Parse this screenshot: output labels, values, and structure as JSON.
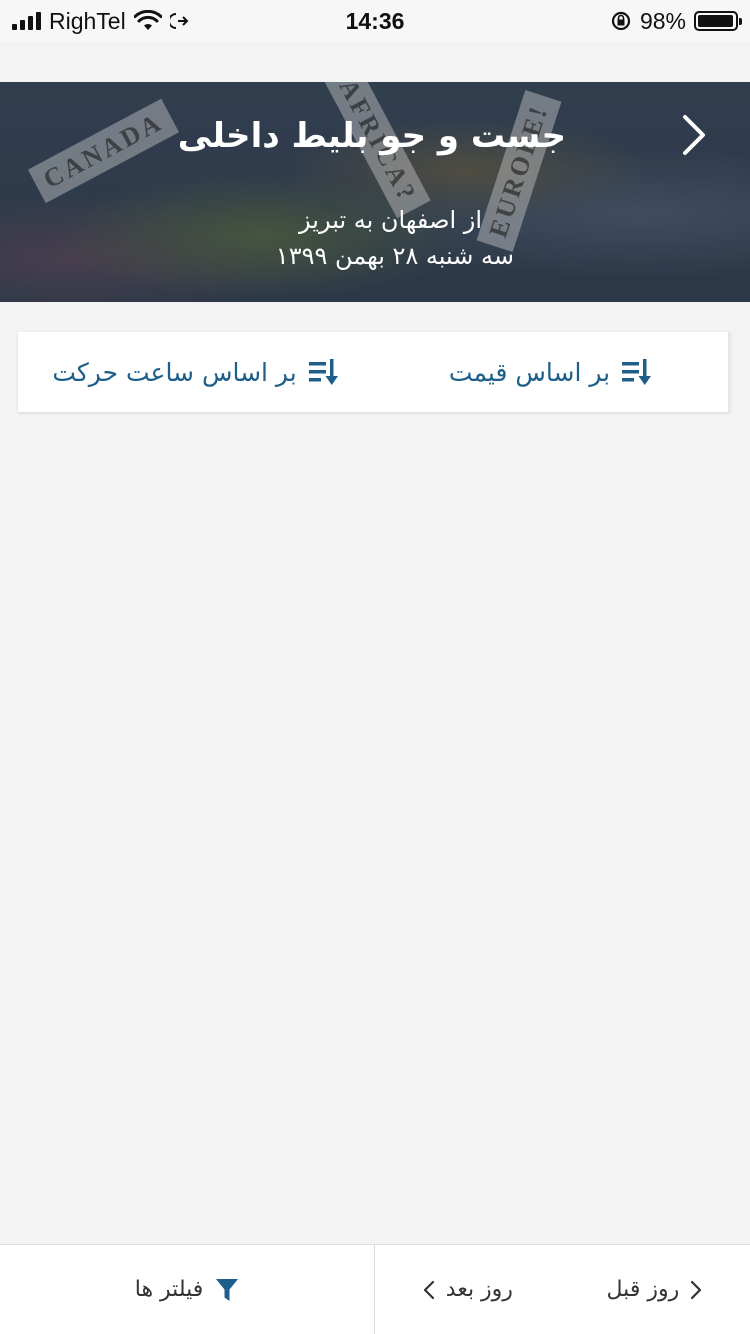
{
  "status_bar": {
    "carrier": "RighTel",
    "time": "14:36",
    "battery": "98%",
    "battery_level": 0.98
  },
  "header": {
    "title": "جست و جو بلیط داخلی",
    "route": "از اصفهان به تبریز",
    "date": "سه شنبه ۲۸ بهمن ۱۳۹۹",
    "background_words": [
      "CANADA",
      "AFRICA?",
      "EUROPE!"
    ]
  },
  "sort": {
    "by_price": "بر اساس قیمت",
    "by_departure": "بر اساس ساعت حرکت"
  },
  "bottom_bar": {
    "filters": "فیلتر ها",
    "next_day": "روز بعد",
    "prev_day": "روز قبل"
  },
  "colors": {
    "accent": "#1d5f8a",
    "background": "#f3f3f3"
  }
}
